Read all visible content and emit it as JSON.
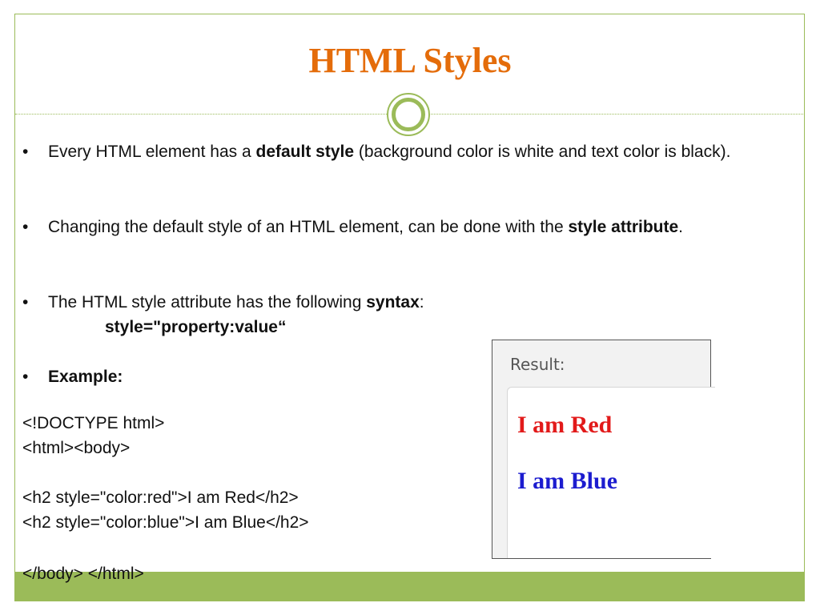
{
  "slide": {
    "title": "HTML Styles",
    "colors": {
      "title": "#e46c0a",
      "accent": "#9bbb59",
      "result_red": "#e21a1a",
      "result_blue": "#1c1ccf"
    }
  },
  "bullets": [
    {
      "bullet_char": "•",
      "pre": "Every HTML element has a ",
      "bold": "default style",
      "post": " (background color is white and text color is black)."
    },
    {
      "bullet_char": "•",
      "pre": "Changing the default style of an HTML element, can be done with the ",
      "bold": "style attribute",
      "post": "."
    },
    {
      "bullet_char": "•",
      "pre": "The HTML style attribute has the following ",
      "bold": "syntax",
      "post": ":"
    },
    {
      "bullet_char": "•",
      "pre": "",
      "bold": "Example:",
      "post": ""
    }
  ],
  "syntax_line": "style=\"property:value“",
  "code_lines": [
    "<!DOCTYPE html>",
    "<html><body>",
    "<h2 style=\"color:red\">I am Red</h2>",
    "<h2 style=\"color:blue\">I am Blue</h2>",
    "</body> </html>"
  ],
  "result": {
    "label": "Result:",
    "red_text": "I am Red",
    "blue_text": "I am Blue"
  }
}
